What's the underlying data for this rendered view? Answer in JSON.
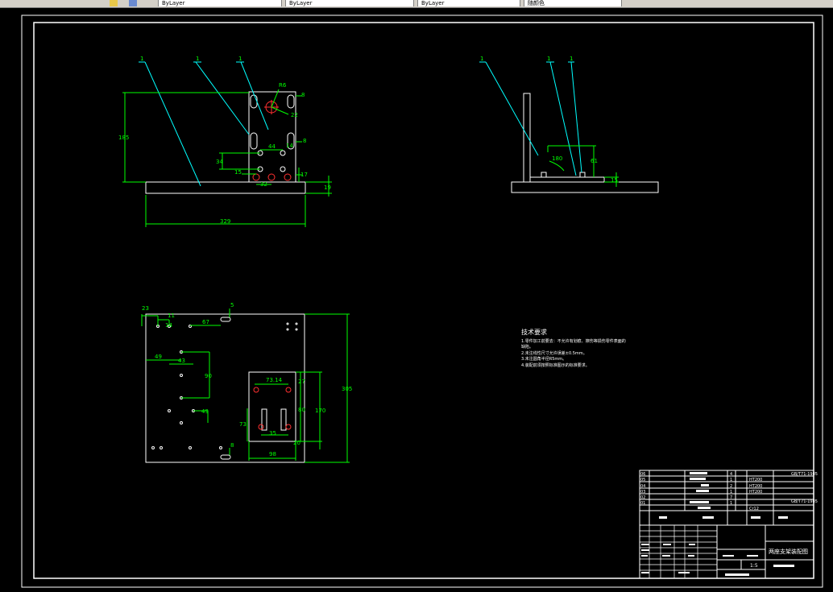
{
  "toolbar": {
    "fields": [
      "ByLayer",
      "ByLayer",
      "ByLayer",
      "随颜色"
    ]
  },
  "dims": {
    "front": {
      "d185": "185",
      "d329": "329",
      "d19": "19",
      "d17": "17",
      "d8a": "8",
      "d8b": "8",
      "d44": "44",
      "d34": "34",
      "d15": "15",
      "d32": "32",
      "d14": "14",
      "r6": "R6",
      "r22": "22",
      "b1": "1",
      "b2": "1",
      "b3": "1"
    },
    "side": {
      "d61": "61",
      "d15": "15",
      "d180": "180",
      "b1": "1",
      "b2": "1",
      "b3": "1"
    },
    "top": {
      "d23": "23",
      "d11": "11",
      "d14": "14",
      "d67": "67",
      "d5": "5",
      "d49a": "49",
      "d43": "43",
      "d90": "90",
      "d49b": "49",
      "d8": "8",
      "d73_14": "73.14",
      "d27": "27",
      "d80": "80",
      "d170": "170",
      "d305": "305",
      "d73": "73",
      "d35": "35",
      "d20": "20",
      "d98": "98"
    }
  },
  "tech": {
    "title": "技术要求",
    "lines": [
      "1.零件加工前要去：不允许有划痕、擦伤等损伤零件表面的",
      "  缺陷。",
      "2.未注线性尺寸允许误差±0.5mm。",
      "3.未注圆角半径R5mm。",
      "4.装配前须按照标准图示的标准要求。"
    ]
  },
  "title_block": {
    "rows": [
      {
        "no": "06",
        "qty": "4",
        "code": "GB/T71-1985",
        "mat": ""
      },
      {
        "no": "05",
        "qty": "1",
        "code": "",
        "mat": "HT200"
      },
      {
        "no": "04",
        "qty": "2",
        "code": "",
        "mat": "HT200"
      },
      {
        "no": "03",
        "qty": "1",
        "code": "",
        "mat": "HT200"
      },
      {
        "no": "02",
        "qty": "7",
        "code": "GB/T71-1985",
        "mat": ""
      },
      {
        "no": "01",
        "qty": "1",
        "code": "",
        "mat": "Cr12"
      }
    ],
    "drawing_name": "两座支架装配图",
    "scale": "1:5"
  }
}
